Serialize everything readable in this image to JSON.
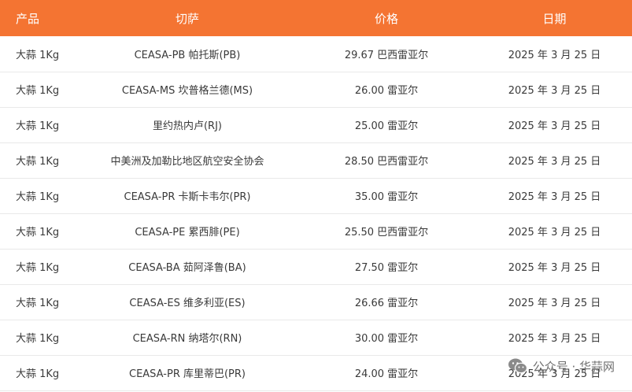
{
  "table": {
    "headers": [
      "产品",
      "切萨",
      "价格",
      "日期"
    ],
    "rows": [
      [
        "大蒜 1Kg",
        "CEASA-PB 帕托斯(PB)",
        "29.67 巴西雷亚尔",
        "2025 年 3 月 25 日"
      ],
      [
        "大蒜 1Kg",
        "CEASA-MS 坎普格兰德(MS)",
        "26.00 雷亚尔",
        "2025 年 3 月 25 日"
      ],
      [
        "大蒜 1Kg",
        "里约热内卢(RJ)",
        "25.00 雷亚尔",
        "2025 年 3 月 25 日"
      ],
      [
        "大蒜 1Kg",
        "中美洲及加勒比地区航空安全协会",
        "28.50 巴西雷亚尔",
        "2025 年 3 月 25 日"
      ],
      [
        "大蒜 1Kg",
        "CEASA-PR 卡斯卡韦尔(PR)",
        "35.00 雷亚尔",
        "2025 年 3 月 25 日"
      ],
      [
        "大蒜 1Kg",
        "CEASA-PE 累西腓(PE)",
        "25.50 巴西雷亚尔",
        "2025 年 3 月 25 日"
      ],
      [
        "大蒜 1Kg",
        "CEASA-BA 茹阿泽鲁(BA)",
        "27.50 雷亚尔",
        "2025 年 3 月 25 日"
      ],
      [
        "大蒜 1Kg",
        "CEASA-ES 维多利亚(ES)",
        "26.66 雷亚尔",
        "2025 年 3 月 25 日"
      ],
      [
        "大蒜 1Kg",
        "CEASA-RN 纳塔尔(RN)",
        "30.00 雷亚尔",
        "2025 年 3 月 25 日"
      ],
      [
        "大蒜 1Kg",
        "CEASA-PR 库里蒂巴(PR)",
        "24.00 雷亚尔",
        "2025 年 3 月 25 日"
      ]
    ]
  },
  "watermark": {
    "icon": "wechat-icon",
    "text": "公众号 · 华蒜网"
  },
  "colors": {
    "header_bg": "#f47432",
    "header_text": "#ffffff",
    "row_divider": "#e9e9e9"
  }
}
